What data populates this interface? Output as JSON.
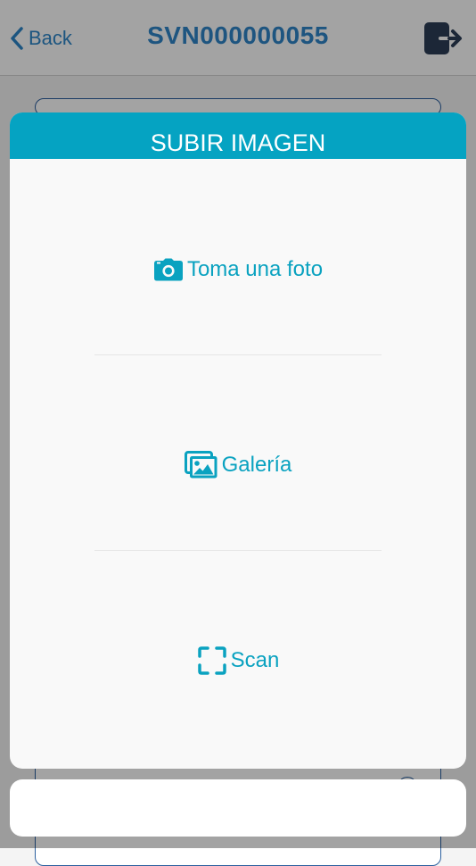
{
  "header": {
    "back_label": "Back",
    "title": "SVN000000055"
  },
  "sheet": {
    "title": "SUBIR IMAGEN",
    "options": [
      {
        "label": "Toma una foto",
        "icon": "camera-icon"
      },
      {
        "label": "Galería",
        "icon": "images-icon"
      },
      {
        "label": "Scan",
        "icon": "scan-icon"
      }
    ],
    "cancel_label": ""
  },
  "colors": {
    "accent": "#05a3c2",
    "option_text": "#0aa2c0",
    "title_blue": "#2f86c9",
    "logout_icon": "#2c3e57"
  }
}
